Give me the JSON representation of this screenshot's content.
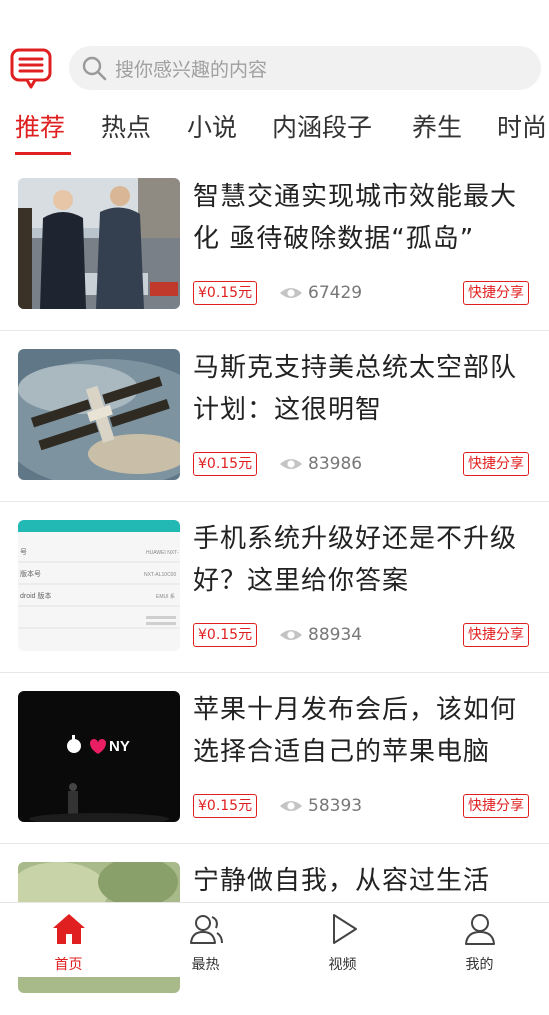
{
  "header": {
    "message_icon": "message-icon",
    "search_placeholder": "搜你感兴趣的内容",
    "search_icon": "search-icon"
  },
  "tabs": [
    {
      "label": "推荐",
      "active": true
    },
    {
      "label": "热点"
    },
    {
      "label": "小说"
    },
    {
      "label": "内涵段子"
    },
    {
      "label": "养生"
    },
    {
      "label": "时尚"
    }
  ],
  "articles": [
    {
      "title": "智慧交通实现城市效能最大化 亟待破除数据“孤岛”",
      "price": "¥0.15元",
      "views": "67429",
      "share": "快捷分享"
    },
    {
      "title": "马斯克支持美总统太空部队计划：这很明智",
      "price": "¥0.15元",
      "views": "83986",
      "share": "快捷分享"
    },
    {
      "title": "手机系统升级好还是不升级好？这里给你答案",
      "price": "¥0.15元",
      "views": "88934",
      "share": "快捷分享"
    },
    {
      "title": "苹果十月发布会后，该如何选择合适自己的苹果电脑",
      "price": "¥0.15元",
      "views": "58393",
      "share": "快捷分享"
    },
    {
      "title": "宁静做自我，从容过生活",
      "price": "",
      "views": "",
      "share": ""
    }
  ],
  "thumb_texts": {
    "phone_rows": [
      "HUAWEI NXT-",
      "NXT-AL10C00",
      "EMUI 系",
      "Android 版本"
    ],
    "phone_labels": [
      "号",
      "版本号",
      "droid 版本"
    ],
    "apple_event": "NY"
  },
  "bottom_nav": [
    {
      "label": "首页",
      "icon": "home-icon",
      "active": true
    },
    {
      "label": "最热",
      "icon": "hot-users-icon"
    },
    {
      "label": "视频",
      "icon": "play-icon"
    },
    {
      "label": "我的",
      "icon": "user-icon"
    }
  ],
  "colors": {
    "accent": "#e02020",
    "divider": "#e8e8e8",
    "search_bg": "#f1f1f1"
  }
}
